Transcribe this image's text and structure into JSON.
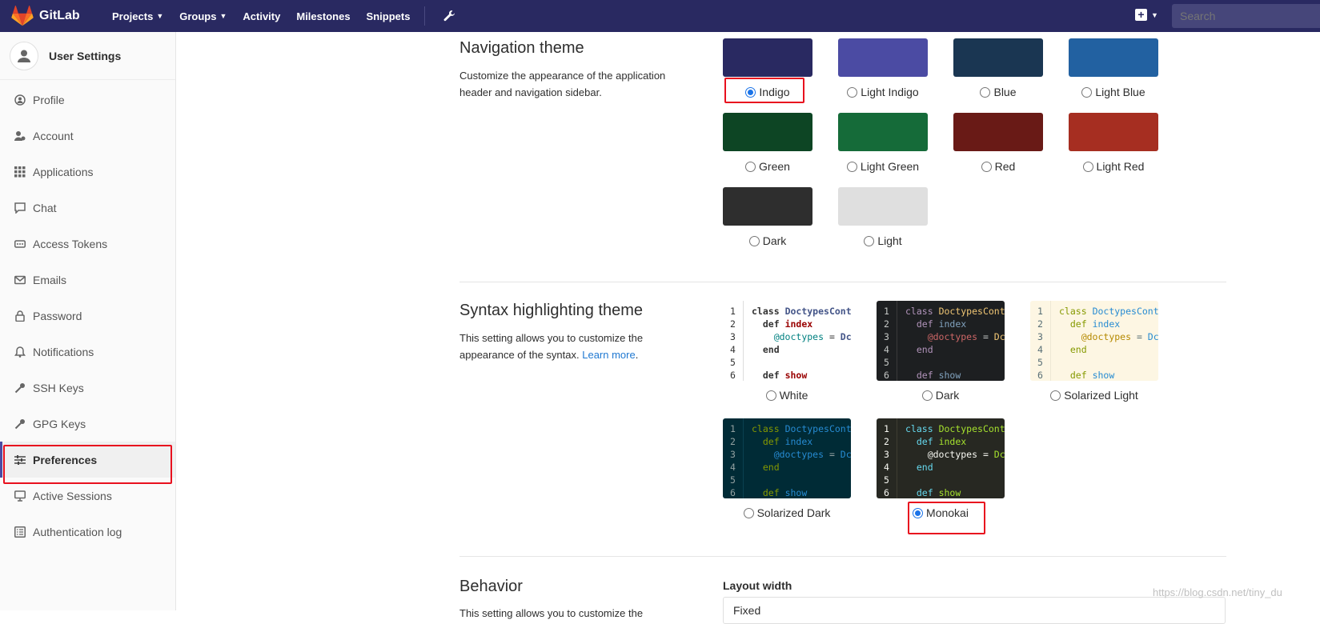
{
  "header": {
    "brand": "GitLab",
    "nav": [
      {
        "label": "Projects",
        "has_caret": true
      },
      {
        "label": "Groups",
        "has_caret": true
      },
      {
        "label": "Activity",
        "has_caret": false
      },
      {
        "label": "Milestones",
        "has_caret": false
      },
      {
        "label": "Snippets",
        "has_caret": false
      }
    ],
    "admin_icon": "wrench-icon",
    "plus_icon": "plus-square-icon",
    "search_placeholder": "Search",
    "background": "#292961"
  },
  "sidebar": {
    "title": "User Settings",
    "items": [
      {
        "label": "Profile",
        "icon": "profile-icon"
      },
      {
        "label": "Account",
        "icon": "account-icon"
      },
      {
        "label": "Applications",
        "icon": "applications-icon"
      },
      {
        "label": "Chat",
        "icon": "chat-icon"
      },
      {
        "label": "Access Tokens",
        "icon": "access-token-icon"
      },
      {
        "label": "Emails",
        "icon": "email-icon"
      },
      {
        "label": "Password",
        "icon": "lock-icon"
      },
      {
        "label": "Notifications",
        "icon": "bell-icon"
      },
      {
        "label": "SSH Keys",
        "icon": "key-icon"
      },
      {
        "label": "GPG Keys",
        "icon": "key-icon"
      },
      {
        "label": "Preferences",
        "icon": "preferences-icon",
        "active": true
      },
      {
        "label": "Active Sessions",
        "icon": "monitor-icon"
      },
      {
        "label": "Authentication log",
        "icon": "list-icon"
      }
    ]
  },
  "navigation_theme": {
    "title": "Navigation theme",
    "description": "Customize the appearance of the application header and navigation sidebar.",
    "options": [
      {
        "label": "Indigo",
        "color": "#292961",
        "checked": true
      },
      {
        "label": "Light Indigo",
        "color": "#4b4ba3",
        "checked": false
      },
      {
        "label": "Blue",
        "color": "#1a3652",
        "checked": false
      },
      {
        "label": "Light Blue",
        "color": "#2261a1",
        "checked": false
      },
      {
        "label": "Green",
        "color": "#0d4524",
        "checked": false
      },
      {
        "label": "Light Green",
        "color": "#156b39",
        "checked": false
      },
      {
        "label": "Red",
        "color": "#691a16",
        "checked": false
      },
      {
        "label": "Light Red",
        "color": "#a62e21",
        "checked": false
      },
      {
        "label": "Dark",
        "color": "#2e2e2e",
        "checked": false
      },
      {
        "label": "Light",
        "color": "#dfdfdf",
        "checked": false
      }
    ]
  },
  "syntax_theme": {
    "title": "Syntax highlighting theme",
    "description": "This setting allows you to customize the appearance of the syntax.",
    "learn_more": "Learn more",
    "line_numbers": [
      "1",
      "2",
      "3",
      "4",
      "5",
      "6"
    ],
    "code": {
      "l1_kw": "class",
      "l1_name": "DoctypesCont",
      "l2_kw": "def",
      "l2_name": "index",
      "l3_var": "@doctypes",
      "l3_op": " = ",
      "l3_rest": "Dc",
      "l4_kw": "end",
      "l6_kw": "def",
      "l6_name": "show"
    },
    "options": [
      {
        "label": "White",
        "checked": false
      },
      {
        "label": "Dark",
        "checked": false
      },
      {
        "label": "Solarized Light",
        "checked": false
      },
      {
        "label": "Solarized Dark",
        "checked": false
      },
      {
        "label": "Monokai",
        "checked": true
      }
    ]
  },
  "behavior": {
    "title": "Behavior",
    "description_visible": "This setting allows you to customize the",
    "layout_width_label": "Layout width",
    "layout_width_value": "Fixed"
  },
  "watermark": "https://blog.csdn.net/tiny_du"
}
